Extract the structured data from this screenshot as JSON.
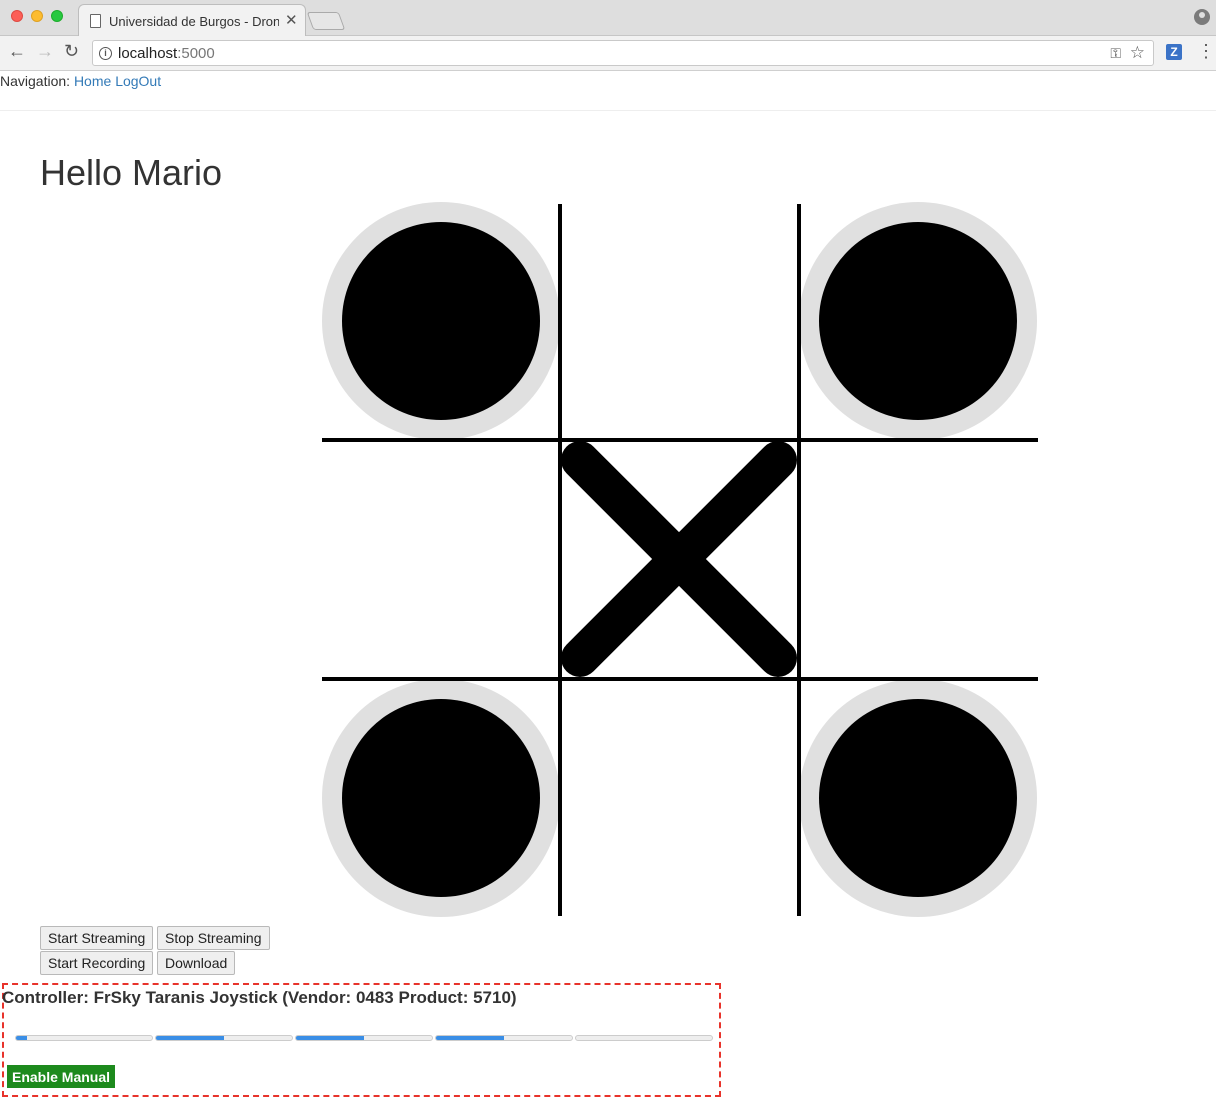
{
  "browser": {
    "tab_title": "Universidad de Burgos - Drone",
    "url_host": "localhost",
    "url_port": ":5000"
  },
  "nav": {
    "label": "Navigation:",
    "home": "Home",
    "logout": "LogOut"
  },
  "page": {
    "title": "Hello Mario"
  },
  "buttons": {
    "start_streaming": "Start Streaming",
    "stop_streaming": "Stop Streaming",
    "start_recording": "Start Recording",
    "download": "Download"
  },
  "controller": {
    "title": "Controller: FrSky Taranis Joystick (Vendor: 0483 Product: 5710)",
    "axes_fill_fraction": [
      0.08,
      0.5,
      0.5,
      0.5,
      0.0
    ],
    "enable_manual": "Enable Manual"
  },
  "colors": {
    "link": "#337ab7",
    "enable_manual_bg": "#1d8a1d",
    "highlight_border": "#e8332b",
    "axis_fill": "#3a8ee6"
  }
}
